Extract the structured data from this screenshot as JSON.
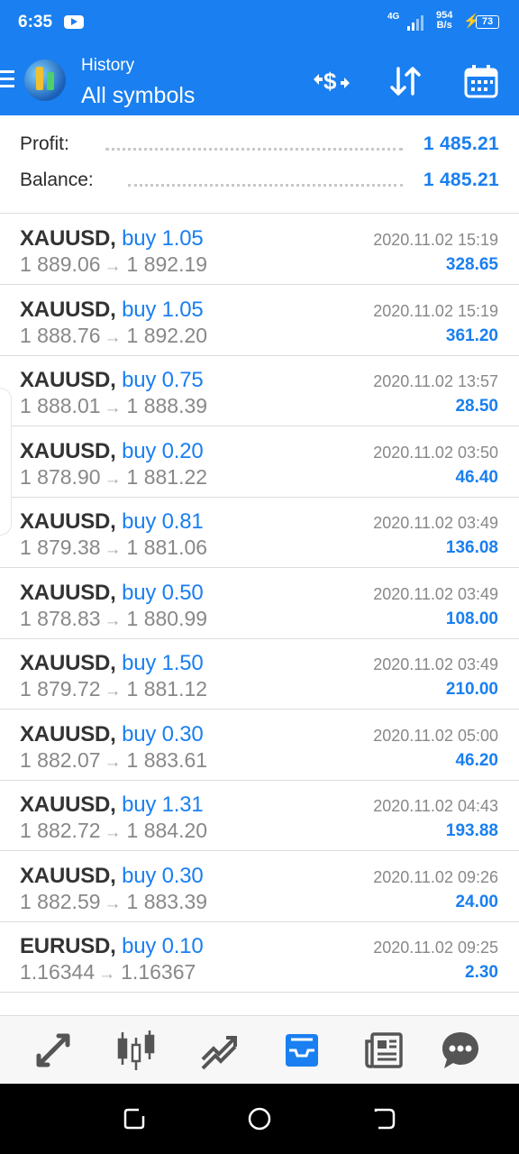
{
  "status_bar": {
    "time": "6:35",
    "network": "4G",
    "speed_value": "954",
    "speed_unit": "B/s",
    "battery": "73"
  },
  "app_bar": {
    "subtitle": "History",
    "title": "All symbols",
    "icons": [
      "menu-icon",
      "logo-icon",
      "deposit-exchange-icon",
      "sort-icon",
      "calendar-icon"
    ]
  },
  "summary": {
    "profit_label": "Profit:",
    "profit_value": "1 485.21",
    "balance_label": "Balance:",
    "balance_value": "1 485.21"
  },
  "trades": [
    {
      "symbol": "XAUUSD,",
      "action": "buy 1.05",
      "open": "1 889.06",
      "close": "1 892.19",
      "time": "2020.11.02 15:19",
      "profit": "328.65"
    },
    {
      "symbol": "XAUUSD,",
      "action": "buy 1.05",
      "open": "1 888.76",
      "close": "1 892.20",
      "time": "2020.11.02 15:19",
      "profit": "361.20"
    },
    {
      "symbol": "XAUUSD,",
      "action": "buy 0.75",
      "open": "1 888.01",
      "close": "1 888.39",
      "time": "2020.11.02 13:57",
      "profit": "28.50"
    },
    {
      "symbol": "XAUUSD,",
      "action": "buy 0.20",
      "open": "1 878.90",
      "close": "1 881.22",
      "time": "2020.11.02 03:50",
      "profit": "46.40"
    },
    {
      "symbol": "XAUUSD,",
      "action": "buy 0.81",
      "open": "1 879.38",
      "close": "1 881.06",
      "time": "2020.11.02 03:49",
      "profit": "136.08"
    },
    {
      "symbol": "XAUUSD,",
      "action": "buy 0.50",
      "open": "1 878.83",
      "close": "1 880.99",
      "time": "2020.11.02 03:49",
      "profit": "108.00"
    },
    {
      "symbol": "XAUUSD,",
      "action": "buy 1.50",
      "open": "1 879.72",
      "close": "1 881.12",
      "time": "2020.11.02 03:49",
      "profit": "210.00"
    },
    {
      "symbol": "XAUUSD,",
      "action": "buy 0.30",
      "open": "1 882.07",
      "close": "1 883.61",
      "time": "2020.11.02 05:00",
      "profit": "46.20"
    },
    {
      "symbol": "XAUUSD,",
      "action": "buy 1.31",
      "open": "1 882.72",
      "close": "1 884.20",
      "time": "2020.11.02 04:43",
      "profit": "193.88"
    },
    {
      "symbol": "XAUUSD,",
      "action": "buy 0.30",
      "open": "1 882.59",
      "close": "1 883.39",
      "time": "2020.11.02 09:26",
      "profit": "24.00"
    },
    {
      "symbol": "EURUSD,",
      "action": "buy 0.10",
      "open": "1.16344",
      "close": "1.16367",
      "time": "2020.11.02 09:25",
      "profit": "2.30"
    }
  ],
  "price_arrow": "→",
  "bottom_nav": {
    "items": [
      "quotes-icon",
      "chart-icon",
      "trade-icon",
      "history-icon",
      "news-icon",
      "chat-icon"
    ],
    "active": "history-icon"
  },
  "colors": {
    "accent": "#1a7ff0",
    "text": "#333333",
    "muted": "#888888"
  }
}
